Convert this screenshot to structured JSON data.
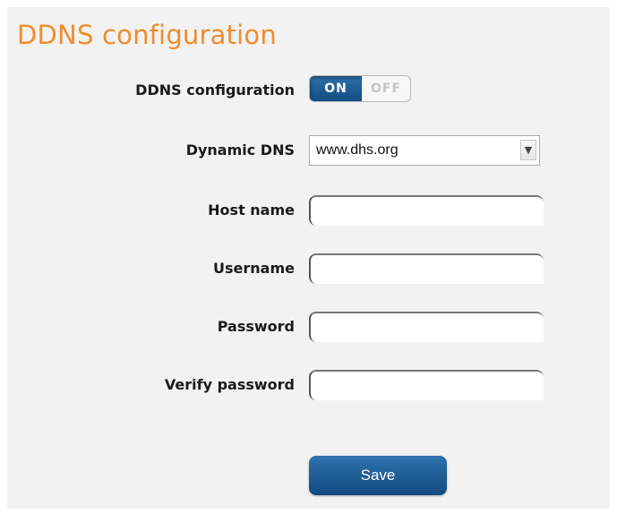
{
  "section": {
    "title": "DDNS configuration"
  },
  "form": {
    "ddns_configuration": {
      "label": "DDNS configuration",
      "toggle": {
        "on_label": "ON",
        "off_label": "OFF",
        "state": "on"
      }
    },
    "dynamic_dns": {
      "label": "Dynamic DNS",
      "selected": "www.dhs.org"
    },
    "host_name": {
      "label": "Host name",
      "value": ""
    },
    "username": {
      "label": "Username",
      "value": ""
    },
    "password": {
      "label": "Password",
      "value": ""
    },
    "verify_password": {
      "label": "Verify password",
      "value": ""
    },
    "save_label": "Save"
  },
  "colors": {
    "title": "#f08c2e",
    "accent": "#134d84",
    "panel_bg": "#f2f2f2"
  }
}
